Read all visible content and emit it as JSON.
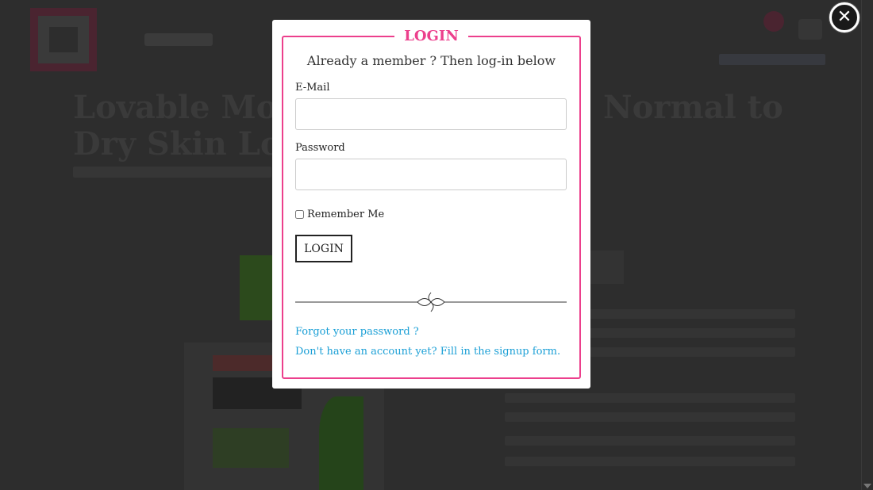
{
  "background": {
    "title_line1": "Lovable Mois",
    "title_line1_end": "Normal to",
    "title_line2": "Dry Skin Lo"
  },
  "modal": {
    "title": "LOGIN",
    "subtitle": "Already a member ? Then log-in below",
    "email_label": "E-Mail",
    "email_value": "",
    "password_label": "Password",
    "password_value": "",
    "remember_label": "Remember Me",
    "remember_checked": false,
    "login_button": "LOGIN",
    "forgot_link": "Forgot your password ?",
    "signup_link": "Don't have an account yet? Fill in the signup form."
  },
  "close_icon": "close-icon",
  "colors": {
    "accent": "#ec3f8c",
    "link": "#1a9fd6",
    "overlay": "#2b2b2b"
  }
}
